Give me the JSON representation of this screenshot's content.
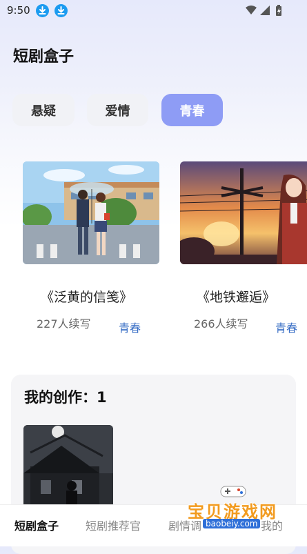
{
  "status_bar": {
    "time": "9:50"
  },
  "app": {
    "title": "短剧盒子"
  },
  "tabs": [
    {
      "label": "悬疑",
      "active": false
    },
    {
      "label": "爱情",
      "active": false
    },
    {
      "label": "青春",
      "active": true
    }
  ],
  "cards": [
    {
      "title": "《泛黄的信笺》",
      "count": "227人续写",
      "tag": "青春"
    },
    {
      "title": "《地铁邂逅》",
      "count": "266人续写",
      "tag": "青春"
    }
  ],
  "my_creation": {
    "title": "我的创作：1"
  },
  "bottom_nav": [
    {
      "label": "短剧盒子",
      "active": true
    },
    {
      "label": "短剧推荐官",
      "active": false
    },
    {
      "label": "剧情调",
      "active": false
    },
    {
      "label": "我的",
      "active": false
    }
  ],
  "watermark": {
    "text": "宝贝游戏网",
    "url": "baobeiy.com"
  },
  "colors": {
    "accent": "#8e9cf5",
    "tag": "#3a6fc6",
    "download_icon": "#1c9bf0"
  }
}
